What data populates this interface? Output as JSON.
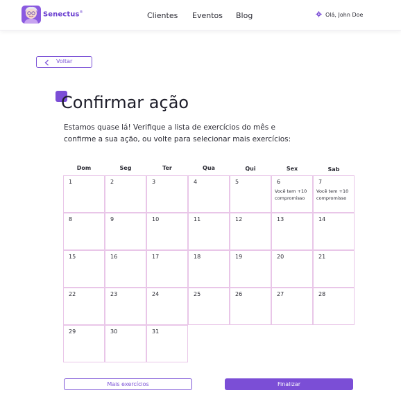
{
  "header": {
    "brand": "Senectus",
    "brand_mark": "®",
    "nav": [
      "Clientes",
      "Eventos",
      "Blog"
    ],
    "user_greeting": "Olá, John Doe",
    "accent": "#7b4ed6"
  },
  "back_label": "Voltar",
  "title": "Confirmar ação",
  "description": "Estamos quase lá! Verifique a lista de exercícios do mês e confirme a sua ação, ou volte para selecionar mais exercícios:",
  "calendar": {
    "weekdays": [
      "Dom",
      "Seg",
      "Ter",
      "Qua",
      "Qui",
      "Sex",
      "Sab"
    ],
    "days": [
      {
        "n": "1"
      },
      {
        "n": "2"
      },
      {
        "n": "3"
      },
      {
        "n": "4"
      },
      {
        "n": "5"
      },
      {
        "n": "6",
        "note": "Você tem +10 compromisso"
      },
      {
        "n": "7",
        "note": "Você tem +10 compromisso"
      },
      {
        "n": "8"
      },
      {
        "n": "9"
      },
      {
        "n": "10"
      },
      {
        "n": "11"
      },
      {
        "n": "12"
      },
      {
        "n": "13"
      },
      {
        "n": "14"
      },
      {
        "n": "15"
      },
      {
        "n": "16"
      },
      {
        "n": "17"
      },
      {
        "n": "18"
      },
      {
        "n": "19"
      },
      {
        "n": "20"
      },
      {
        "n": "21"
      },
      {
        "n": "22"
      },
      {
        "n": "23"
      },
      {
        "n": "24"
      },
      {
        "n": "25"
      },
      {
        "n": "26"
      },
      {
        "n": "27"
      },
      {
        "n": "28"
      },
      {
        "n": "29"
      },
      {
        "n": "30"
      },
      {
        "n": "31"
      }
    ]
  },
  "buttons": {
    "more": "Mais exercícios",
    "finish": "Finalizar"
  }
}
